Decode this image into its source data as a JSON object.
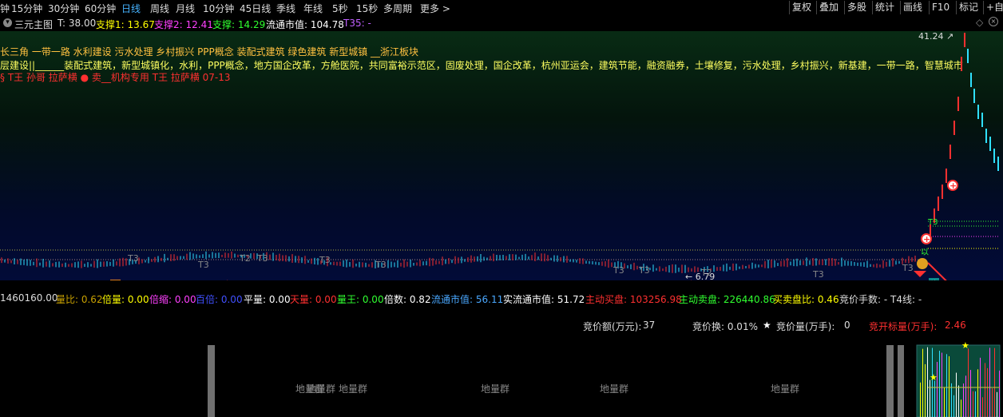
{
  "toolbar": {
    "timeframes": [
      "钟",
      "15分钟",
      "30分钟",
      "60分钟",
      "日线",
      "周线",
      "月线",
      "10分钟",
      "45日线",
      "季线",
      "年线",
      "5秒",
      "15秒",
      "多周期",
      "更多 >"
    ],
    "active_timeframe": "日线",
    "right_buttons": [
      "复权",
      "叠加",
      "多股",
      "统计",
      "画线",
      "F10",
      "标记",
      "+自"
    ]
  },
  "infoline": {
    "title": "三元主图",
    "t": "T: 38.00",
    "support1": "支撑1: 13.67",
    "support2": "支撑2: 12.41",
    "support": "支撑: 14.29",
    "float_mv": "流通市值: 104.78",
    "t35": "T35: -"
  },
  "main": {
    "concept_line1": "长三角 一带一路 水利建设 污水处理 乡村振兴 PPP概念 装配式建筑 绿色建筑 新型城镇 __浙江板块",
    "concept_line2": "层建设||______装配式建筑，新型城镇化，水利，PPP概念，地方国企改革，方舱医院，共同富裕示范区，固废处理，国企改革，杭州亚运会，建筑节能，融资融券，土壤修复，污水处理，乡村振兴，新基建，一带一路，智慧城市",
    "concept_line3": "§ T王 孙哥 拉萨横 ● 卖__机构专用 T王 拉萨横   07-13",
    "high_label": "41.24",
    "low_label": "6.79",
    "t3_marks": [
      "T3",
      "T3",
      "T2",
      "T3",
      "T3",
      "T3",
      "T3",
      "T3",
      "T2",
      "T3",
      "T3"
    ],
    "markers": {
      "ding": "定",
      "dollar1": "$",
      "dollar2": "$",
      "ting": "停",
      "t3_green": "T3",
      "q": "以"
    }
  },
  "indicators": {
    "lead": "1460160.00",
    "items": [
      {
        "label": "量比:",
        "value": "0.62",
        "color": "#c8a000"
      },
      {
        "label": "倍量:",
        "value": "0.00",
        "color": "#ffff00"
      },
      {
        "label": "倍缩:",
        "value": "0.00",
        "color": "#ff40ff"
      },
      {
        "label": "百倍:",
        "value": "0.00",
        "color": "#4050ff"
      },
      {
        "label": "平量:",
        "value": "0.00",
        "color": "#ffffff"
      },
      {
        "label": "天量:",
        "value": "0.00",
        "color": "#ff3030"
      },
      {
        "label": "量王:",
        "value": "0.00",
        "color": "#30ff30"
      },
      {
        "label": "倍数:",
        "value": "0.82",
        "color": "#ffffff"
      },
      {
        "label": "流通市值:",
        "value": "56.11",
        "color": "#4aa8ff"
      },
      {
        "label": "实流通市值:",
        "value": "51.72",
        "color": "#ffffff"
      },
      {
        "label": "主动买盘:",
        "value": "103256.98",
        "color": "#ff3030"
      },
      {
        "label": "主动卖盘:",
        "value": "226440.86",
        "color": "#30ff30"
      },
      {
        "label": "买卖盘比:",
        "value": "0.46",
        "color": "#ffff00"
      },
      {
        "label": "竞价手数:",
        "value": "-",
        "color": "#dddddd"
      },
      {
        "label": "T4线:",
        "value": "-",
        "color": "#dddddd"
      }
    ]
  },
  "auction": {
    "amount_label": "竞价额(万元):",
    "amount_value": "37",
    "turnover": "竞价换: 0.01%",
    "star": "★",
    "volume_label": "竞价量(万手):",
    "volume_value": "0",
    "ratio_label": "竞开标量(万手):",
    "ratio_value": "2.46"
  },
  "bottom": {
    "labels": [
      "地量群",
      "地量群",
      "地量群",
      "地量群",
      "地量群",
      "地量群"
    ]
  },
  "colors": {
    "up": "#ff3030",
    "down": "#30e0ff",
    "accent": "#46b3ff"
  }
}
